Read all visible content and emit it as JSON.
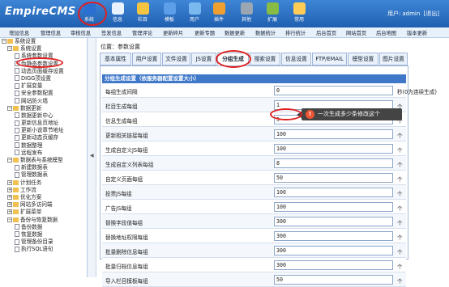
{
  "app": {
    "logo": "EmpireCMS"
  },
  "top_nav": [
    {
      "label": "系统",
      "icon": "globe-icon"
    },
    {
      "label": "信息",
      "icon": "document-icon"
    },
    {
      "label": "栏目",
      "icon": "folder-icon"
    },
    {
      "label": "模板",
      "icon": "template-icon"
    },
    {
      "label": "用户",
      "icon": "user-icon"
    },
    {
      "label": "插件",
      "icon": "plugin-icon"
    },
    {
      "label": "其他",
      "icon": "gear-icon"
    },
    {
      "label": "扩展",
      "icon": "extension-icon"
    },
    {
      "label": "常用",
      "icon": "star-icon"
    }
  ],
  "user": {
    "prefix": "用户:",
    "name": "admin",
    "logout": "[退出]"
  },
  "menubar": [
    "增加信息",
    "管理信息",
    "审核信息",
    "签发信息",
    "管理评论",
    "更新碎片",
    "更新专题",
    "数据更新",
    "数据统计",
    "排行统计",
    "后台首页",
    "网站首页",
    "后台地图",
    "版本更新"
  ],
  "sidebar": [
    {
      "level": 0,
      "type": "folder",
      "text": "系统设置",
      "toggle": "−"
    },
    {
      "level": 1,
      "type": "folder",
      "text": "系统设置",
      "toggle": "−"
    },
    {
      "level": 2,
      "type": "doc",
      "text": "系统参数设置"
    },
    {
      "level": 2,
      "type": "doc",
      "text": "伪静态参数设置"
    },
    {
      "level": 2,
      "type": "doc",
      "text": "动态页面缓存设置"
    },
    {
      "level": 2,
      "type": "doc",
      "text": "DIGG顶设置"
    },
    {
      "level": 2,
      "type": "doc",
      "text": "扩展变量"
    },
    {
      "level": 2,
      "type": "doc",
      "text": "安全参数配置"
    },
    {
      "level": 2,
      "type": "doc",
      "text": "网站防火墙"
    },
    {
      "level": 1,
      "type": "folder",
      "text": "数据更新",
      "toggle": "−"
    },
    {
      "level": 2,
      "type": "doc",
      "text": "数据更新中心"
    },
    {
      "level": 2,
      "type": "doc",
      "text": "更新信息页地址"
    },
    {
      "level": 2,
      "type": "doc",
      "text": "更新小说章节地址"
    },
    {
      "level": 2,
      "type": "doc",
      "text": "更新动态页缓存"
    },
    {
      "level": 2,
      "type": "doc",
      "text": "数据整理"
    },
    {
      "level": 2,
      "type": "doc",
      "text": "远程发布"
    },
    {
      "level": 1,
      "type": "folder",
      "text": "数据表与系统模型",
      "toggle": "−"
    },
    {
      "level": 2,
      "type": "doc",
      "text": "新建数据表"
    },
    {
      "level": 2,
      "type": "doc",
      "text": "管理数据表"
    },
    {
      "level": 1,
      "type": "folder",
      "text": "计划任务",
      "toggle": "+"
    },
    {
      "level": 1,
      "type": "folder",
      "text": "工作流",
      "toggle": "+"
    },
    {
      "level": 1,
      "type": "folder",
      "text": "优化方案",
      "toggle": "+"
    },
    {
      "level": 1,
      "type": "folder",
      "text": "网站多访问端",
      "toggle": "+"
    },
    {
      "level": 1,
      "type": "folder",
      "text": "扩展菜单",
      "toggle": "+"
    },
    {
      "level": 1,
      "type": "folder",
      "text": "备份与恢复数据",
      "toggle": "−"
    },
    {
      "level": 2,
      "type": "doc",
      "text": "备份数据"
    },
    {
      "level": 2,
      "type": "doc",
      "text": "恢复数据"
    },
    {
      "level": 2,
      "type": "doc",
      "text": "管理备份目录"
    },
    {
      "level": 2,
      "type": "doc",
      "text": "执行SQL语句"
    }
  ],
  "splitter_glyph": "◀",
  "breadcrumb": "位置：参数设置",
  "tabs": [
    "基本属性",
    "用户设置",
    "文件设置",
    "JS设置",
    "分组生成",
    "搜索设置",
    "信息设置",
    "FTP/EMAIL",
    "模型设置",
    "图片设置"
  ],
  "active_tab": "分组生成",
  "panel_title": "分组生成设置（依服务器配置设置大小）",
  "rows": [
    {
      "label": "每组生成间隔",
      "value": "0",
      "unit": "秒(0为连续生成)"
    },
    {
      "label": "栏目生成每组",
      "value": "1",
      "unit": "个"
    },
    {
      "label": "信息生成每组",
      "value": "5",
      "unit": "个"
    },
    {
      "label": "更新相关链接每组",
      "value": "100",
      "unit": "个"
    },
    {
      "label": "生成自定义JS每组",
      "value": "100",
      "unit": "个"
    },
    {
      "label": "生成自定义列表每组",
      "value": "8",
      "unit": "个"
    },
    {
      "label": "自定义页面每组",
      "value": "50",
      "unit": "个"
    },
    {
      "label": "投票JS每组",
      "value": "100",
      "unit": "个"
    },
    {
      "label": "广告JS每组",
      "value": "100",
      "unit": "个"
    },
    {
      "label": "替换字段值每组",
      "value": "300",
      "unit": "个"
    },
    {
      "label": "替换地址权限每组",
      "value": "300",
      "unit": "个"
    },
    {
      "label": "批量删除信息每组",
      "value": "300",
      "unit": "个"
    },
    {
      "label": "批量归档信息每组",
      "value": "300",
      "unit": "个"
    },
    {
      "label": "导入栏目模板每组",
      "value": "50",
      "unit": "个"
    }
  ],
  "tooltip": {
    "icon": "!",
    "text": "一次生成多少条修改这个"
  }
}
